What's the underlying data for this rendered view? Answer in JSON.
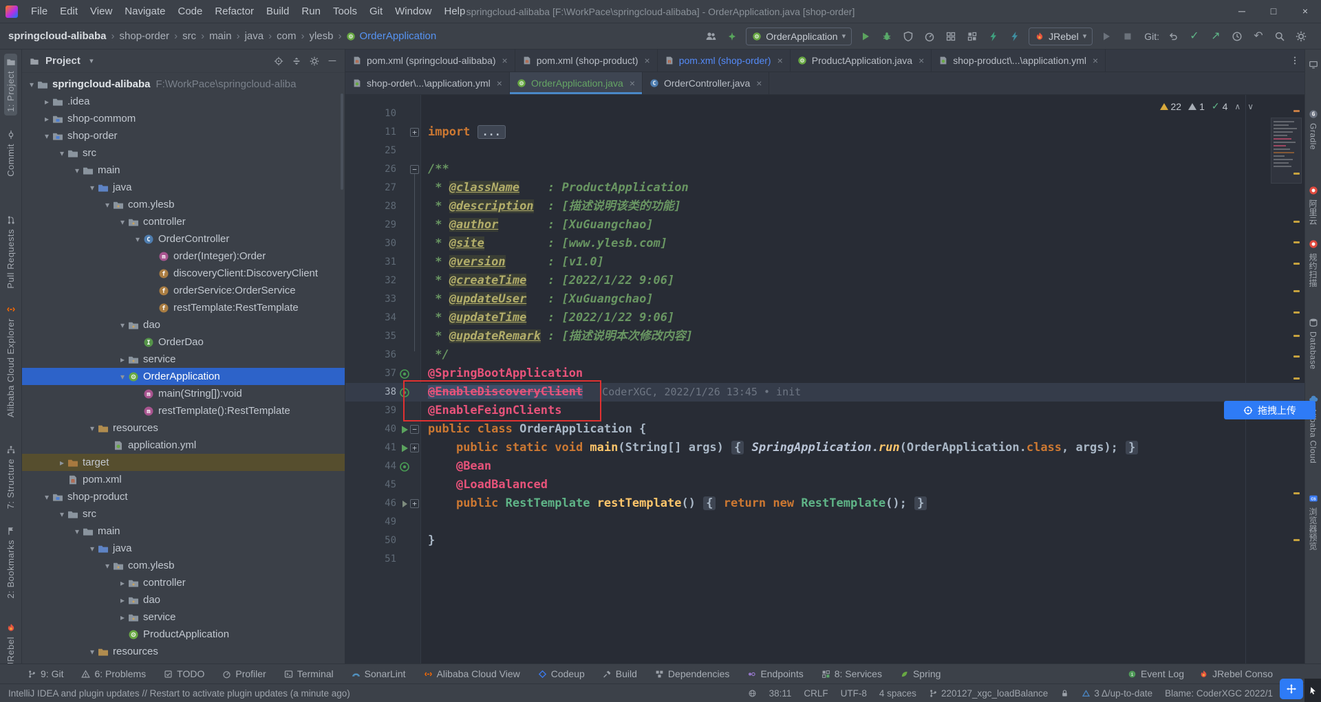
{
  "window": {
    "title": "springcloud-alibaba [F:\\WorkPace\\springcloud-alibaba] - OrderApplication.java [shop-order]",
    "minimize": "─",
    "maximize": "□",
    "close": "×"
  },
  "menu": [
    "File",
    "Edit",
    "View",
    "Navigate",
    "Code",
    "Refactor",
    "Build",
    "Run",
    "Tools",
    "Git",
    "Window",
    "Help"
  ],
  "breadcrumbs": [
    "springcloud-alibaba",
    "shop-order",
    "src",
    "main",
    "java",
    "com",
    "ylesb",
    "OrderApplication"
  ],
  "toolbar": {
    "run_config": "OrderApplication",
    "jrebel": "JRebel",
    "git_label": "Git:"
  },
  "tabs_row1": [
    {
      "label": "pom.xml (springcloud-alibaba)",
      "icon": "maven",
      "state": "default"
    },
    {
      "label": "pom.xml (shop-product)",
      "icon": "maven",
      "state": "default"
    },
    {
      "label": "pom.xml (shop-order)",
      "icon": "maven",
      "state": "modified"
    },
    {
      "label": "ProductApplication.java",
      "icon": "springboot",
      "state": "default"
    },
    {
      "label": "shop-product\\...\\application.yml",
      "icon": "yml",
      "state": "default"
    }
  ],
  "tabs_row2": [
    {
      "label": "shop-order\\...\\application.yml",
      "icon": "yml",
      "state": "default"
    },
    {
      "label": "OrderApplication.java",
      "icon": "springboot",
      "state": "added",
      "active": true
    },
    {
      "label": "OrderController.java",
      "icon": "class",
      "state": "default"
    }
  ],
  "project": {
    "title": "Project",
    "tree": [
      {
        "l": "springcloud-alibaba",
        "d": "F:\\WorkPace\\springcloud-aliba",
        "lv": 0,
        "ch": "o",
        "ic": "project",
        "b": true
      },
      {
        "l": ".idea",
        "lv": 1,
        "ch": "c",
        "ic": "folder"
      },
      {
        "l": "shop-commom",
        "lv": 1,
        "ch": "c",
        "ic": "module"
      },
      {
        "l": "shop-order",
        "lv": 1,
        "ch": "o",
        "ic": "module"
      },
      {
        "l": "src",
        "lv": 2,
        "ch": "o",
        "ic": "folder"
      },
      {
        "l": "main",
        "lv": 3,
        "ch": "o",
        "ic": "folder"
      },
      {
        "l": "java",
        "lv": 4,
        "ch": "o",
        "ic": "javaroot"
      },
      {
        "l": "com.ylesb",
        "lv": 5,
        "ch": "o",
        "ic": "package"
      },
      {
        "l": "controller",
        "lv": 6,
        "ch": "o",
        "ic": "package"
      },
      {
        "l": "OrderController",
        "lv": 7,
        "ch": "o",
        "ic": "class"
      },
      {
        "l": "order(Integer):Order",
        "lv": 8,
        "ic": "method"
      },
      {
        "l": "discoveryClient:DiscoveryClient",
        "lv": 8,
        "ic": "field"
      },
      {
        "l": "orderService:OrderService",
        "lv": 8,
        "ic": "field"
      },
      {
        "l": "restTemplate:RestTemplate",
        "lv": 8,
        "ic": "field"
      },
      {
        "l": "dao",
        "lv": 6,
        "ch": "o",
        "ic": "package"
      },
      {
        "l": "OrderDao",
        "lv": 7,
        "ic": "interface"
      },
      {
        "l": "service",
        "lv": 6,
        "ch": "c",
        "ic": "package"
      },
      {
        "l": "OrderApplication",
        "lv": 6,
        "ch": "o",
        "ic": "springboot",
        "sel": true
      },
      {
        "l": "main(String[]):void",
        "lv": 7,
        "ic": "method"
      },
      {
        "l": "restTemplate():RestTemplate",
        "lv": 7,
        "ic": "method"
      },
      {
        "l": "resources",
        "lv": 4,
        "ch": "o",
        "ic": "resroot"
      },
      {
        "l": "application.yml",
        "lv": 5,
        "ic": "yml"
      },
      {
        "l": "target",
        "lv": 2,
        "ch": "c",
        "ic": "folderex",
        "hi": true
      },
      {
        "l": "pom.xml",
        "lv": 2,
        "ic": "maven"
      },
      {
        "l": "shop-product",
        "lv": 1,
        "ch": "o",
        "ic": "module"
      },
      {
        "l": "src",
        "lv": 2,
        "ch": "o",
        "ic": "folder"
      },
      {
        "l": "main",
        "lv": 3,
        "ch": "o",
        "ic": "folder"
      },
      {
        "l": "java",
        "lv": 4,
        "ch": "o",
        "ic": "javaroot"
      },
      {
        "l": "com.ylesb",
        "lv": 5,
        "ch": "o",
        "ic": "package"
      },
      {
        "l": "controller",
        "lv": 6,
        "ch": "c",
        "ic": "package"
      },
      {
        "l": "dao",
        "lv": 6,
        "ch": "c",
        "ic": "package"
      },
      {
        "l": "service",
        "lv": 6,
        "ch": "c",
        "ic": "package"
      },
      {
        "l": "ProductApplication",
        "lv": 6,
        "ic": "springboot"
      },
      {
        "l": "resources",
        "lv": 4,
        "ch": "o",
        "ic": "resroot"
      }
    ]
  },
  "editor": {
    "inspections": {
      "warnings": "22",
      "weak": "1",
      "ok": "4"
    },
    "lines": [
      {
        "n": "10"
      },
      {
        "n": "11",
        "fold": "plus",
        "tk": [
          [
            "kw",
            "import "
          ],
          [
            "fell",
            "..."
          ]
        ]
      },
      {
        "n": "25"
      },
      {
        "n": "26",
        "fold": "minus",
        "tk": [
          [
            "doc",
            "/**"
          ]
        ]
      },
      {
        "n": "27",
        "tk": [
          [
            "doc",
            " * "
          ],
          [
            "dtag",
            "@className"
          ],
          [
            "doc",
            "    : ProductApplication"
          ]
        ]
      },
      {
        "n": "28",
        "tk": [
          [
            "doc",
            " * "
          ],
          [
            "dtag",
            "@description"
          ],
          [
            "doc",
            "  : [描述说明该类的功能]"
          ]
        ]
      },
      {
        "n": "29",
        "tk": [
          [
            "doc",
            " * "
          ],
          [
            "dtag",
            "@author"
          ],
          [
            "doc",
            "       : [XuGuangchao]"
          ]
        ]
      },
      {
        "n": "30",
        "tk": [
          [
            "doc",
            " * "
          ],
          [
            "dtag",
            "@site"
          ],
          [
            "doc",
            "         : [www.ylesb.com]"
          ]
        ]
      },
      {
        "n": "31",
        "tk": [
          [
            "doc",
            " * "
          ],
          [
            "dtag",
            "@version"
          ],
          [
            "doc",
            "      : [v1.0]"
          ]
        ]
      },
      {
        "n": "32",
        "tk": [
          [
            "doc",
            " * "
          ],
          [
            "dtag",
            "@createTime"
          ],
          [
            "doc",
            "   : [2022/1/22 9:06]"
          ]
        ]
      },
      {
        "n": "33",
        "tk": [
          [
            "doc",
            " * "
          ],
          [
            "dtag",
            "@updateUser"
          ],
          [
            "doc",
            "   : [XuGuangchao]"
          ]
        ]
      },
      {
        "n": "34",
        "tk": [
          [
            "doc",
            " * "
          ],
          [
            "dtag",
            "@updateTime"
          ],
          [
            "doc",
            "   : [2022/1/22 9:06]"
          ]
        ]
      },
      {
        "n": "35",
        "tk": [
          [
            "doc",
            " * "
          ],
          [
            "dtag",
            "@updateRemark"
          ],
          [
            "doc",
            " : [描述说明本次修改内容]"
          ]
        ]
      },
      {
        "n": "36",
        "tk": [
          [
            "doc",
            " */"
          ]
        ]
      },
      {
        "n": "37",
        "g": "spring",
        "tk": [
          [
            "ann",
            "@SpringBootApplication"
          ]
        ]
      },
      {
        "n": "38",
        "g": "spring",
        "hl": true,
        "blame": "CoderXGC, 2022/1/26 13:45 • init",
        "tk": [
          [
            "anns",
            "@EnableDiscoveryClient"
          ]
        ]
      },
      {
        "n": "39",
        "tk": [
          [
            "ann",
            "@EnableFeignClients"
          ]
        ]
      },
      {
        "n": "40",
        "g": "run",
        "fold": "minus",
        "tk": [
          [
            "kw",
            "public class "
          ],
          [
            "plain",
            "OrderApplication {"
          ]
        ]
      },
      {
        "n": "41",
        "g": "run",
        "fold": "plus",
        "tk": [
          [
            "plain",
            "    "
          ],
          [
            "kw",
            "public static void "
          ],
          [
            "mth",
            "main"
          ],
          [
            "plain",
            "(String[] args) "
          ],
          [
            "fbr",
            "{"
          ],
          [
            "plain",
            " "
          ],
          [
            "sit",
            "SpringApplication"
          ],
          [
            "plain",
            "."
          ],
          [
            "smth",
            "run"
          ],
          [
            "plain",
            "(OrderApplication."
          ],
          [
            "kw",
            "class"
          ],
          [
            "plain",
            ", args); "
          ],
          [
            "fbr",
            "}"
          ]
        ]
      },
      {
        "n": "44",
        "g": "spring",
        "tk": [
          [
            "plain",
            "    "
          ],
          [
            "ann",
            "@Bean"
          ]
        ]
      },
      {
        "n": "45",
        "tk": [
          [
            "plain",
            "    "
          ],
          [
            "ann",
            "@LoadBalanced"
          ]
        ]
      },
      {
        "n": "46",
        "g": "bean",
        "fold": "plus",
        "tk": [
          [
            "plain",
            "    "
          ],
          [
            "kw",
            "public "
          ],
          [
            "cls",
            "RestTemplate"
          ],
          [
            "plain",
            " "
          ],
          [
            "mth",
            "restTemplate"
          ],
          [
            "plain",
            "() "
          ],
          [
            "fbr",
            "{"
          ],
          [
            "plain",
            " "
          ],
          [
            "kw",
            "return new "
          ],
          [
            "cls",
            "RestTemplate"
          ],
          [
            "plain",
            "(); "
          ],
          [
            "fbr",
            "}"
          ]
        ]
      },
      {
        "n": "49"
      },
      {
        "n": "50",
        "tk": [
          [
            "plain",
            "}"
          ]
        ]
      },
      {
        "n": "51"
      }
    ]
  },
  "left_stripe": [
    {
      "label": "1: Project",
      "icon": "projectstripe",
      "active": true
    },
    {
      "label": "Commit",
      "icon": "commitic"
    },
    {
      "label": "Pull Requests",
      "icon": "pr"
    },
    {
      "label": "Alibaba Cloud Explorer",
      "icon": "alicloud"
    },
    {
      "label": "7: Structure",
      "icon": "structure"
    },
    {
      "label": "2: Bookmarks",
      "icon": "flag"
    },
    {
      "label": "JRebel",
      "icon": "jrebel"
    }
  ],
  "right_stripe": [
    {
      "label": "",
      "icon": "monitor"
    },
    {
      "label": "Gradle",
      "icon": "gradle"
    },
    {
      "label": "阿里云",
      "icon": "red"
    },
    {
      "label": "规约扫描",
      "icon": "red"
    },
    {
      "label": "Database",
      "icon": "db"
    },
    {
      "label": "Alibaba Cloud",
      "icon": "cloudblue"
    },
    {
      "label": "浏览器预览",
      "icon": "cs"
    }
  ],
  "bottom_bar": {
    "left": [
      {
        "label": "9: Git",
        "icon": "gitbranch"
      },
      {
        "label": "6: Problems",
        "icon": "problems"
      },
      {
        "label": "TODO",
        "icon": "todo"
      },
      {
        "label": "Profiler",
        "icon": "profiler"
      },
      {
        "label": "Terminal",
        "icon": "terminal"
      },
      {
        "label": "SonarLint",
        "icon": "sonar"
      },
      {
        "label": "Alibaba Cloud View",
        "icon": "alicloud"
      },
      {
        "label": "Codeup",
        "icon": "codeup"
      },
      {
        "label": "Build",
        "icon": "build"
      },
      {
        "label": "Dependencies",
        "icon": "deps"
      },
      {
        "label": "Endpoints",
        "icon": "endpoints"
      },
      {
        "label": "8: Services",
        "icon": "services"
      },
      {
        "label": "Spring",
        "icon": "springleaf"
      }
    ],
    "right": [
      {
        "label": "Event Log",
        "icon": "event"
      },
      {
        "label": "JRebel Conso",
        "icon": "jrebel"
      }
    ]
  },
  "status_bar": {
    "message": "IntelliJ IDEA and plugin updates // Restart to activate plugin updates (a minute ago)",
    "caret": "38:11",
    "line_sep": "CRLF",
    "encoding": "UTF-8",
    "indent": "4 spaces",
    "branch": "220127_xgc_loadBalance",
    "sync": "3 Δ/up-to-date",
    "blame": "Blame: CoderXGC 2022/1"
  },
  "overlays": {
    "drag_upload": "拖拽上传"
  },
  "colors": {
    "accent": "#4A88C7",
    "selection": "#2D63C9",
    "annotation": "#E8537A",
    "keyword": "#CC7832",
    "error_box": "#E03131",
    "added": "#65A564",
    "modified": "#548AF7"
  }
}
